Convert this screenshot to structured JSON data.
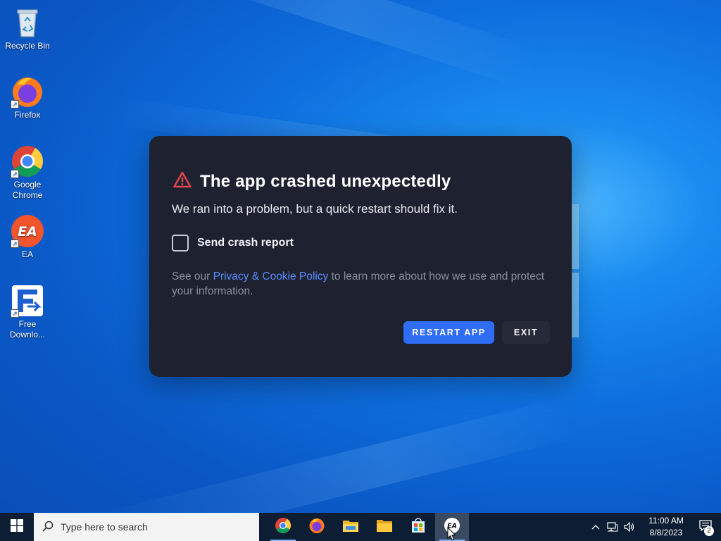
{
  "desktop": {
    "icons": [
      {
        "label": "Recycle Bin",
        "icon": "recycle-bin-icon"
      },
      {
        "label": "Firefox",
        "icon": "firefox-icon"
      },
      {
        "label": "Google Chrome",
        "icon": "chrome-icon"
      },
      {
        "label": "EA",
        "icon": "ea-icon"
      },
      {
        "label": "Free Downlo...",
        "icon": "free-download-manager-icon"
      }
    ]
  },
  "dialog": {
    "title": "The app crashed unexpectedly",
    "subtitle": "We ran into a problem, but a quick restart should fix it.",
    "checkbox_label": "Send crash report",
    "checkbox_checked": false,
    "policy_prefix": "See our ",
    "policy_link": "Privacy & Cookie Policy",
    "policy_suffix": " to learn more about how we use and protect your information.",
    "restart_label": "RESTART APP",
    "exit_label": "EXIT",
    "accent_color": "#2f6df5",
    "warning_color": "#e8454f"
  },
  "taskbar": {
    "search_placeholder": "Type here to search",
    "apps": [
      "chrome-icon",
      "firefox-icon",
      "file-explorer-icon",
      "folder-icon",
      "microsoft-store-icon",
      "ea-icon"
    ],
    "clock_time": "11:00 AM",
    "clock_date": "8/8/2023",
    "notification_count": "2"
  }
}
